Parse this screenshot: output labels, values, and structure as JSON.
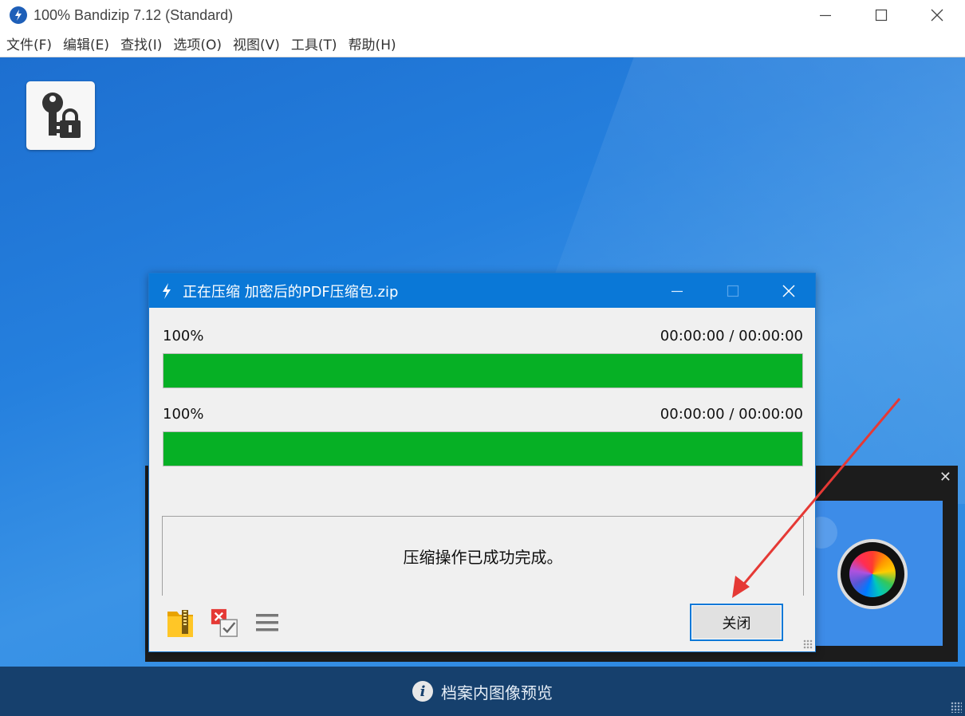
{
  "window": {
    "title": "100% Bandizip 7.12 (Standard)",
    "minimize_icon": "minimize-icon",
    "maximize_icon": "maximize-icon",
    "close_icon": "close-icon"
  },
  "menu": [
    {
      "label": "文件(F)"
    },
    {
      "label": "编辑(E)"
    },
    {
      "label": "查找(I)"
    },
    {
      "label": "选项(O)"
    },
    {
      "label": "视图(V)"
    },
    {
      "label": "工具(T)"
    },
    {
      "label": "帮助(H)"
    }
  ],
  "main": {
    "key_tile_icon": "key-lock-icon"
  },
  "dialog": {
    "title": "正在压缩 加密后的PDF压缩包.zip",
    "progress": [
      {
        "percent": "100%",
        "time": "00:00:00 / 00:00:00",
        "fill": 1.0
      },
      {
        "percent": "100%",
        "time": "00:00:00 / 00:00:00",
        "fill": 1.0
      }
    ],
    "status_message": "压缩操作已成功完成。",
    "close_button": "关闭",
    "footer_icons": [
      "open-folder-icon",
      "delete-check-icon",
      "menu-icon"
    ]
  },
  "preview": {
    "label": "档案内图像预览",
    "info_glyph": "i"
  },
  "colors": {
    "accent": "#0a78d7",
    "progress_green": "#06b025",
    "background_blue": "#2580de",
    "preview_bar": "#16406d",
    "annotation_red": "#e53935"
  }
}
